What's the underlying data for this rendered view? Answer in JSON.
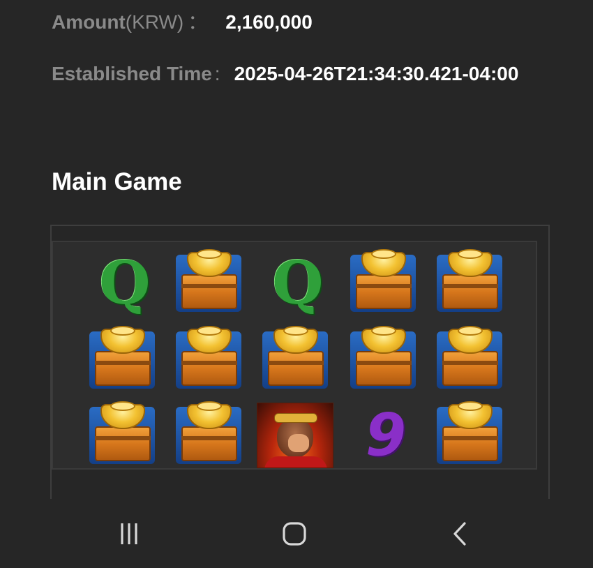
{
  "details": {
    "amount_label": "Amount",
    "amount_unit": "(KRW)",
    "amount_colon": "：",
    "amount_value": "2,160,000",
    "time_label": "Established Time",
    "time_colon": ":",
    "time_value": "2025-04-26T21:34:30.421-04:00"
  },
  "main_game": {
    "title": "Main Game",
    "grid": [
      [
        "Q",
        "gold-chest",
        "Q",
        "gold-chest",
        "gold-chest"
      ],
      [
        "gold-chest",
        "gold-chest",
        "gold-chest",
        "gold-chest",
        "gold-chest"
      ],
      [
        "gold-chest",
        "gold-chest",
        "monkey-king",
        "9",
        "gold-chest"
      ]
    ],
    "colors": {
      "q_symbol": "#2fa03a",
      "nine_symbol": "#8a2fc8",
      "chest_gold": "#f3c232",
      "chest_back": "#2a6cc4"
    }
  },
  "navbar": {
    "icons": [
      "recent-apps-icon",
      "home-icon",
      "back-icon"
    ]
  }
}
